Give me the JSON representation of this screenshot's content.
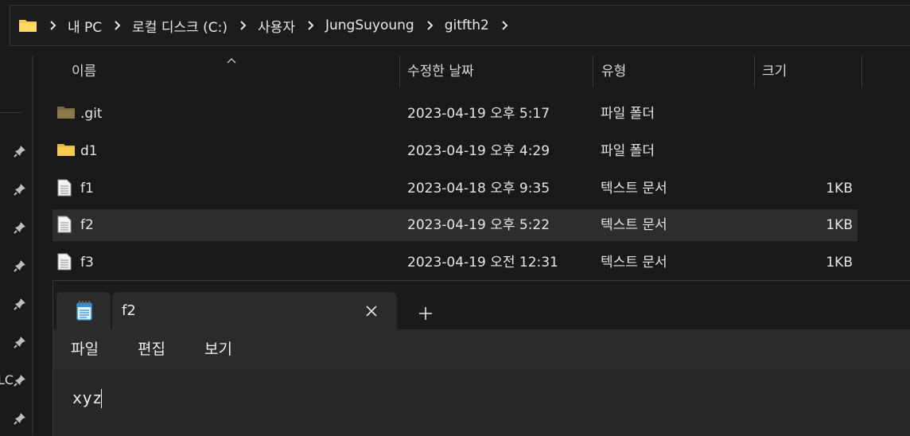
{
  "breadcrumb": {
    "items": [
      "내 PC",
      "로컬 디스크 (C:)",
      "사용자",
      "JungSuyoung",
      "gitfth2"
    ]
  },
  "icons": {
    "folder": "folder-icon",
    "text_file": "text-file-icon",
    "pin": "pin-icon",
    "chevron": "chevron-right-icon",
    "sort": "sort-up-icon",
    "notepad": "notepad-icon",
    "close": "close-icon",
    "add": "add-tab-icon"
  },
  "colors": {
    "background": "#191919",
    "selected_row": "#2d2d2d",
    "folder_yellow": "#f8c94a",
    "folder_git": "#8a7a4a"
  },
  "columns": {
    "name": "이름",
    "modified": "수정한 날짜",
    "type": "유형",
    "size": "크기"
  },
  "files": [
    {
      "name": ".git",
      "modified": "2023-04-19 오후 5:17",
      "type": "파일 폴더",
      "size": "",
      "icon": "folder-git"
    },
    {
      "name": "d1",
      "modified": "2023-04-19 오후 4:29",
      "type": "파일 폴더",
      "size": "",
      "icon": "folder"
    },
    {
      "name": "f1",
      "modified": "2023-04-18 오후 9:35",
      "type": "텍스트 문서",
      "size": "1KB",
      "icon": "text-file"
    },
    {
      "name": "f2",
      "modified": "2023-04-19 오후 5:22",
      "type": "텍스트 문서",
      "size": "1KB",
      "icon": "text-file",
      "selected": true
    },
    {
      "name": "f3",
      "modified": "2023-04-19 오전 12:31",
      "type": "텍스트 문서",
      "size": "1KB",
      "icon": "text-file"
    }
  ],
  "left_nav": {
    "partial_label": "LC"
  },
  "notepad": {
    "tab_title": "f2",
    "menu": {
      "file": "파일",
      "edit": "편집",
      "view": "보기"
    },
    "content": "xyz"
  }
}
